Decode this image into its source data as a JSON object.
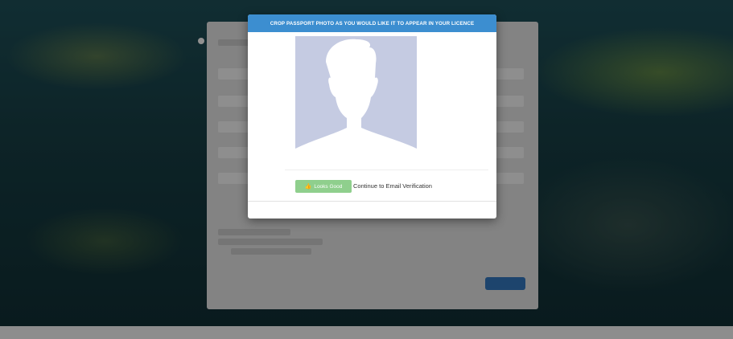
{
  "modal": {
    "title": "CROP PASSPORT PHOTO AS YOU WOULD LIKE IT TO APPEAR IN YOUR LICENCE",
    "looks_good_label": "Looks Good",
    "looks_good_icon": "thumbs-up-icon",
    "continue_text": "Continue to Email Verification"
  },
  "colors": {
    "header": "#3c8ed0",
    "looks_good": "#8fcf8d",
    "photo_placeholder": "#c5cbe2"
  }
}
